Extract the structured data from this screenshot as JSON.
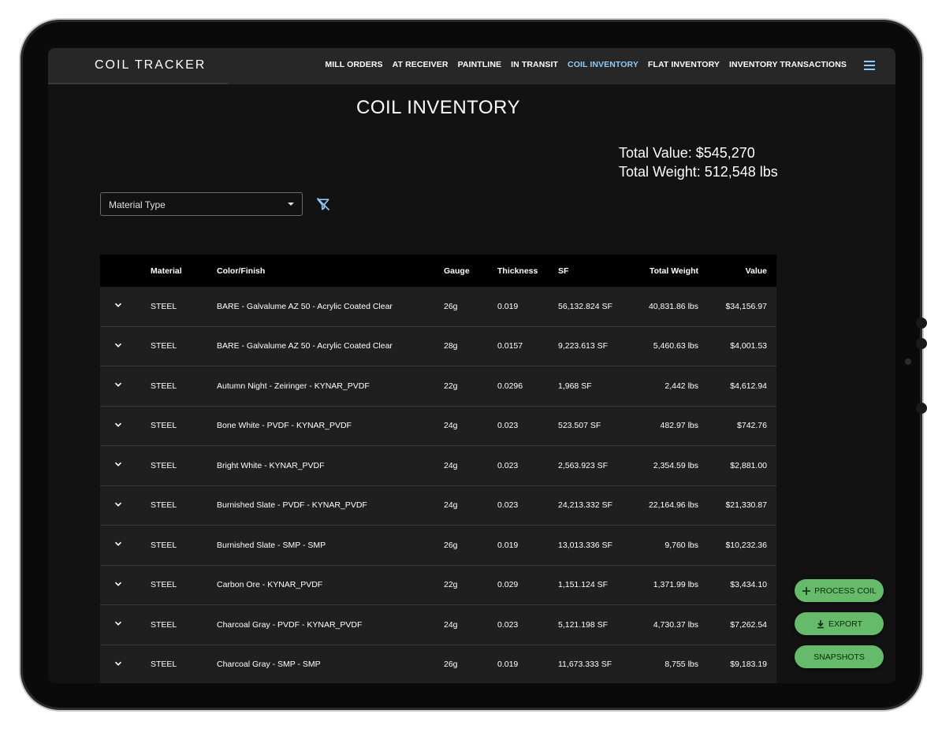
{
  "app": {
    "brand": "COIL TRACKER"
  },
  "nav": {
    "items": [
      {
        "label": "MILL ORDERS",
        "active": false
      },
      {
        "label": "AT RECEIVER",
        "active": false
      },
      {
        "label": "PAINTLINE",
        "active": false
      },
      {
        "label": "IN TRANSIT",
        "active": false
      },
      {
        "label": "COIL INVENTORY",
        "active": true
      },
      {
        "label": "FLAT INVENTORY",
        "active": false
      },
      {
        "label": "INVENTORY TRANSACTIONS",
        "active": false
      }
    ],
    "menu_icon": "hamburger-menu-icon"
  },
  "page": {
    "title": "COIL INVENTORY"
  },
  "totals": {
    "value": "Total Value: $545,270",
    "weight": "Total Weight: 512,548 lbs"
  },
  "filter": {
    "label": "Material Type",
    "clear_icon": "filter-clear-icon"
  },
  "table": {
    "headers": {
      "material": "Material",
      "color": "Color/Finish",
      "gauge": "Gauge",
      "thickness": "Thickness",
      "sf": "SF",
      "weight": "Total Weight",
      "value": "Value"
    },
    "rows": [
      {
        "material": "STEEL",
        "color": "BARE - Galvalume AZ 50 - Acrylic Coated Clear",
        "gauge": "26g",
        "thickness": "0.019",
        "sf": "56,132.824 SF",
        "weight": "40,831.86 lbs",
        "value": "$34,156.97"
      },
      {
        "material": "STEEL",
        "color": "BARE - Galvalume AZ 50 - Acrylic Coated Clear",
        "gauge": "28g",
        "thickness": "0.0157",
        "sf": "9,223.613 SF",
        "weight": "5,460.63 lbs",
        "value": "$4,001.53"
      },
      {
        "material": "STEEL",
        "color": "Autumn Night - Zeiringer - KYNAR_PVDF",
        "gauge": "22g",
        "thickness": "0.0296",
        "sf": "1,968 SF",
        "weight": "2,442 lbs",
        "value": "$4,612.94"
      },
      {
        "material": "STEEL",
        "color": "Bone White - PVDF - KYNAR_PVDF",
        "gauge": "24g",
        "thickness": "0.023",
        "sf": "523.507 SF",
        "weight": "482.97 lbs",
        "value": "$742.76"
      },
      {
        "material": "STEEL",
        "color": "Bright White - KYNAR_PVDF",
        "gauge": "24g",
        "thickness": "0.023",
        "sf": "2,563.923 SF",
        "weight": "2,354.59 lbs",
        "value": "$2,881.00"
      },
      {
        "material": "STEEL",
        "color": "Burnished Slate - PVDF - KYNAR_PVDF",
        "gauge": "24g",
        "thickness": "0.023",
        "sf": "24,213.332 SF",
        "weight": "22,164.96 lbs",
        "value": "$21,330.87"
      },
      {
        "material": "STEEL",
        "color": "Burnished Slate - SMP - SMP",
        "gauge": "26g",
        "thickness": "0.019",
        "sf": "13,013.336 SF",
        "weight": "9,760 lbs",
        "value": "$10,232.36"
      },
      {
        "material": "STEEL",
        "color": "Carbon Ore - KYNAR_PVDF",
        "gauge": "22g",
        "thickness": "0.029",
        "sf": "1,151.124 SF",
        "weight": "1,371.99 lbs",
        "value": "$3,434.10"
      },
      {
        "material": "STEEL",
        "color": "Charcoal Gray - PVDF - KYNAR_PVDF",
        "gauge": "24g",
        "thickness": "0.023",
        "sf": "5,121.198 SF",
        "weight": "4,730.37 lbs",
        "value": "$7,262.54"
      },
      {
        "material": "STEEL",
        "color": "Charcoal Gray - SMP - SMP",
        "gauge": "26g",
        "thickness": "0.019",
        "sf": "11,673.333 SF",
        "weight": "8,755 lbs",
        "value": "$9,183.19"
      }
    ]
  },
  "actions": {
    "process": {
      "label": "PROCESS COIL",
      "icon": "plus-icon"
    },
    "export": {
      "label": "EXPORT",
      "icon": "download-icon"
    },
    "snapshots": {
      "label": "SNAPSHOTS"
    }
  },
  "colors": {
    "accent": "#90caf9",
    "fab": "#66bb6a",
    "background": "#121212",
    "appbar": "#272727",
    "row": "#1f1f1f"
  }
}
